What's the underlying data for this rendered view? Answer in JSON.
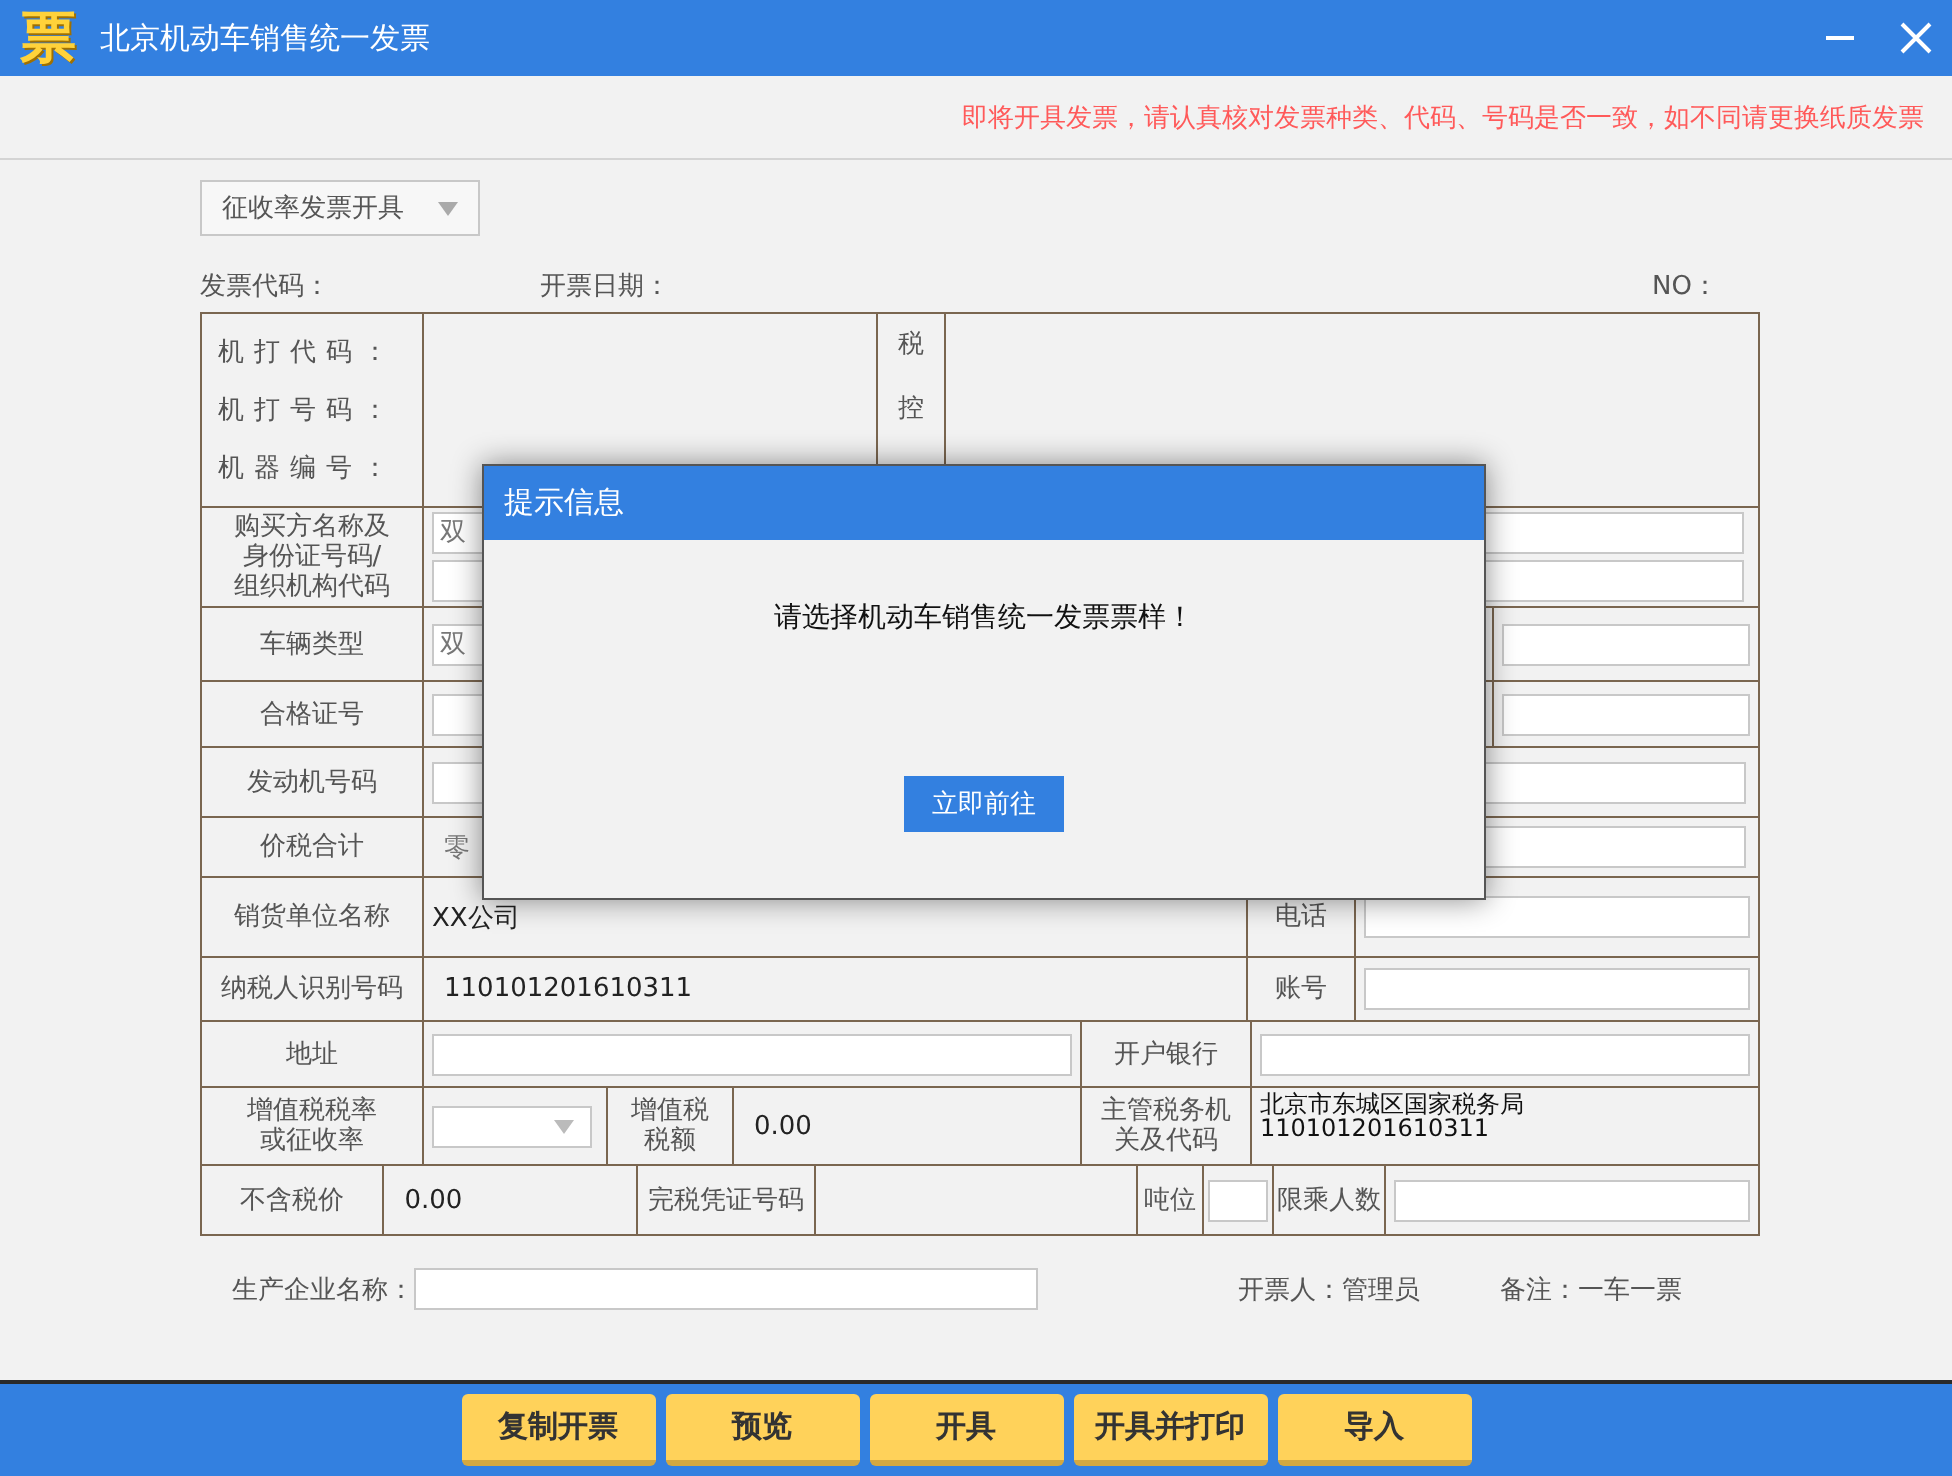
{
  "window": {
    "logo": "票",
    "title": "北京机动车销售统一发票"
  },
  "notice": "即将开具发票，请认真核对发票种类、代码、号码是否一致，如不同请更换纸质发票",
  "mode_select": {
    "value": "征收率发票开具"
  },
  "header": {
    "code_label": "发票代码：",
    "date_label": "开票日期：",
    "no_label": "NO："
  },
  "machine": {
    "labels": [
      "机打代码：",
      "机打号码：",
      "机器编号："
    ],
    "tax_control_label": [
      "税",
      "控"
    ]
  },
  "buyer": {
    "label": "购买方名称及身份证号码/组织机构代码",
    "placeholder": "双"
  },
  "vehicle_type": {
    "label": "车辆类型",
    "placeholder": "双"
  },
  "cert": {
    "label": "合格证号"
  },
  "engine": {
    "label": "发动机号码"
  },
  "total": {
    "label": "价税合计",
    "value": "零"
  },
  "seller": {
    "label": "销货单位名称",
    "value": "XX公司",
    "phone_label": "电话"
  },
  "taxpayer_id": {
    "label": "纳税人识别号码",
    "value": "110101201610311",
    "account_label": "账号"
  },
  "address": {
    "label": "地址",
    "bank_label": "开户银行"
  },
  "vat": {
    "rate_label": "增值税税率或征收率",
    "amount_label": "增值税税额",
    "amount": "0.00",
    "authority_label": "主管税务机关及代码",
    "authority": [
      "北京市东城区国家税务局",
      "110101201610311"
    ]
  },
  "price": {
    "label": "不含税价",
    "value": "0.00",
    "receipt_label": "完税凭证号码",
    "tonnage_label": "吨位",
    "passengers_label": "限乘人数"
  },
  "footer": {
    "manufacturer_label": "生产企业名称：",
    "issuer": "开票人：管理员",
    "remark": "备注：一车一票"
  },
  "buttons": [
    "复制开票",
    "预览",
    "开具",
    "开具并打印",
    "导入"
  ],
  "dialog": {
    "title": "提示信息",
    "message": "请选择机动车销售统一发票票样！",
    "button": "立即前往"
  }
}
